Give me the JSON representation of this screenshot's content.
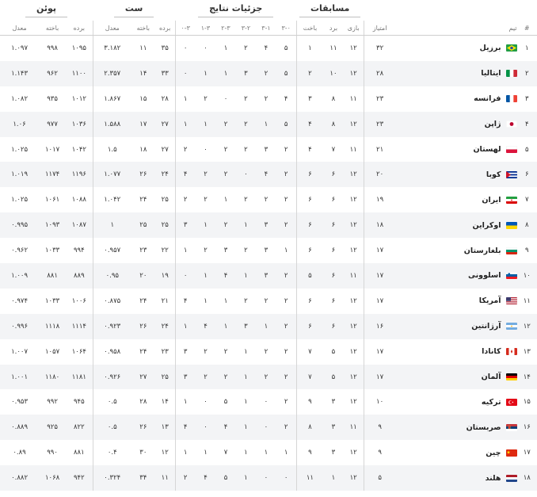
{
  "headers": {
    "groups": {
      "matches": "مسابقات",
      "details": "جزئیات نتایج",
      "sets": "ست",
      "points": "پوئن"
    },
    "columns": {
      "num": "#",
      "team": "تیم",
      "score": "امتیاز",
      "played": "بازی",
      "won": "برد",
      "lost": "باخت",
      "r30": "۳-۰",
      "r31": "۳-۱",
      "r32": "۳-۲",
      "r23": "۲-۳",
      "r13": "۱-۳",
      "r03": "۰-۳",
      "sets_won": "برده",
      "sets_lost": "باخته",
      "sets_ratio": "معدل",
      "pts_won": "برده",
      "pts_lost": "باخته",
      "pts_ratio": "معدل"
    }
  },
  "rows": [
    {
      "rank": "۱",
      "team": "برزیل",
      "flag": "brazil",
      "score": "۳۲",
      "played": "۱۲",
      "won": "۱۱",
      "lost": "۱",
      "r30": "۵",
      "r31": "۴",
      "r32": "۲",
      "r23": "۱",
      "r13": "۰",
      "r03": "۰",
      "sets_won": "۳۵",
      "sets_lost": "۱۱",
      "sets_ratio": "۳.۱۸۲",
      "pts_won": "۱۰۹۵",
      "pts_lost": "۹۹۸",
      "pts_ratio": "۱.۰۹۷"
    },
    {
      "rank": "۲",
      "team": "ایتالیا",
      "flag": "italy",
      "score": "۲۸",
      "played": "۱۲",
      "won": "۱۰",
      "lost": "۲",
      "r30": "۵",
      "r31": "۲",
      "r32": "۳",
      "r23": "۱",
      "r13": "۱",
      "r03": "۰",
      "sets_won": "۳۳",
      "sets_lost": "۱۴",
      "sets_ratio": "۲.۳۵۷",
      "pts_won": "۱۱۰۰",
      "pts_lost": "۹۶۲",
      "pts_ratio": "۱.۱۴۳"
    },
    {
      "rank": "۳",
      "team": "فرانسه",
      "flag": "france",
      "score": "۲۳",
      "played": "۱۱",
      "won": "۸",
      "lost": "۳",
      "r30": "۴",
      "r31": "۲",
      "r32": "۲",
      "r23": "۰",
      "r13": "۲",
      "r03": "۱",
      "sets_won": "۲۸",
      "sets_lost": "۱۵",
      "sets_ratio": "۱.۸۶۷",
      "pts_won": "۱۰۱۲",
      "pts_lost": "۹۳۵",
      "pts_ratio": "۱.۰۸۲"
    },
    {
      "rank": "۴",
      "team": "ژاپن",
      "flag": "japan",
      "score": "۲۳",
      "played": "۱۲",
      "won": "۸",
      "lost": "۴",
      "r30": "۵",
      "r31": "۱",
      "r32": "۲",
      "r23": "۲",
      "r13": "۱",
      "r03": "۱",
      "sets_won": "۲۷",
      "sets_lost": "۱۷",
      "sets_ratio": "۱.۵۸۸",
      "pts_won": "۱۰۳۶",
      "pts_lost": "۹۷۷",
      "pts_ratio": "۱.۰۶"
    },
    {
      "rank": "۵",
      "team": "لهستان",
      "flag": "poland",
      "score": "۲۱",
      "played": "۱۱",
      "won": "۷",
      "lost": "۴",
      "r30": "۲",
      "r31": "۳",
      "r32": "۲",
      "r23": "۲",
      "r13": "۰",
      "r03": "۲",
      "sets_won": "۲۷",
      "sets_lost": "۱۸",
      "sets_ratio": "۱.۵",
      "pts_won": "۱۰۴۲",
      "pts_lost": "۱۰۱۷",
      "pts_ratio": "۱.۰۲۵"
    },
    {
      "rank": "۶",
      "team": "کوبا",
      "flag": "cuba",
      "score": "۲۰",
      "played": "۱۲",
      "won": "۶",
      "lost": "۶",
      "r30": "۲",
      "r31": "۴",
      "r32": "۰",
      "r23": "۲",
      "r13": "۲",
      "r03": "۴",
      "sets_won": "۲۴",
      "sets_lost": "۲۶",
      "sets_ratio": "۱.۰۷۷",
      "pts_won": "۱۱۹۶",
      "pts_lost": "۱۱۷۴",
      "pts_ratio": "۱.۰۱۹"
    },
    {
      "rank": "۷",
      "team": "ایران",
      "flag": "iran",
      "score": "۱۹",
      "played": "۱۲",
      "won": "۶",
      "lost": "۶",
      "r30": "۲",
      "r31": "۲",
      "r32": "۲",
      "r23": "۱",
      "r13": "۲",
      "r03": "۲",
      "sets_won": "۲۵",
      "sets_lost": "۲۴",
      "sets_ratio": "۱.۰۴۲",
      "pts_won": "۱۰۸۸",
      "pts_lost": "۱۰۶۱",
      "pts_ratio": "۱.۰۲۵"
    },
    {
      "rank": "۸",
      "team": "اوکراین",
      "flag": "ukraine",
      "score": "۱۸",
      "played": "۱۲",
      "won": "۶",
      "lost": "۶",
      "r30": "۲",
      "r31": "۳",
      "r32": "۱",
      "r23": "۲",
      "r13": "۱",
      "r03": "۳",
      "sets_won": "۲۵",
      "sets_lost": "۲۵",
      "sets_ratio": "۱",
      "pts_won": "۱۰۸۷",
      "pts_lost": "۱۰۹۳",
      "pts_ratio": "۰.۹۹۵"
    },
    {
      "rank": "۹",
      "team": "بلغارستان",
      "flag": "bulgaria",
      "score": "۱۷",
      "played": "۱۲",
      "won": "۶",
      "lost": "۶",
      "r30": "۱",
      "r31": "۳",
      "r32": "۲",
      "r23": "۳",
      "r13": "۲",
      "r03": "۱",
      "sets_won": "۲۲",
      "sets_lost": "۲۳",
      "sets_ratio": "۰.۹۵۷",
      "pts_won": "۹۹۴",
      "pts_lost": "۱۰۳۳",
      "pts_ratio": "۰.۹۶۲"
    },
    {
      "rank": "۱۰",
      "team": "اسلوونی",
      "flag": "slovenia",
      "score": "۱۷",
      "played": "۱۱",
      "won": "۶",
      "lost": "۵",
      "r30": "۲",
      "r31": "۳",
      "r32": "۱",
      "r23": "۴",
      "r13": "۱",
      "r03": "۰",
      "sets_won": "۱۹",
      "sets_lost": "۲۰",
      "sets_ratio": "۰.۹۵",
      "pts_won": "۸۸۹",
      "pts_lost": "۸۸۱",
      "pts_ratio": "۱.۰۰۹"
    },
    {
      "rank": "۱۱",
      "team": "آمریکا",
      "flag": "usa",
      "score": "۱۷",
      "played": "۱۲",
      "won": "۶",
      "lost": "۶",
      "r30": "۲",
      "r31": "۲",
      "r32": "۲",
      "r23": "۱",
      "r13": "۱",
      "r03": "۴",
      "sets_won": "۲۱",
      "sets_lost": "۲۴",
      "sets_ratio": "۰.۸۷۵",
      "pts_won": "۱۰۰۶",
      "pts_lost": "۱۰۳۳",
      "pts_ratio": "۰.۹۷۴"
    },
    {
      "rank": "۱۲",
      "team": "آرژانتین",
      "flag": "argentina",
      "score": "۱۶",
      "played": "۱۲",
      "won": "۶",
      "lost": "۶",
      "r30": "۲",
      "r31": "۱",
      "r32": "۳",
      "r23": "۱",
      "r13": "۴",
      "r03": "۱",
      "sets_won": "۲۴",
      "sets_lost": "۲۶",
      "sets_ratio": "۰.۹۲۳",
      "pts_won": "۱۱۱۴",
      "pts_lost": "۱۱۱۸",
      "pts_ratio": "۰.۹۹۶"
    },
    {
      "rank": "۱۳",
      "team": "کانادا",
      "flag": "canada",
      "score": "۱۷",
      "played": "۱۲",
      "won": "۵",
      "lost": "۷",
      "r30": "۲",
      "r31": "۲",
      "r32": "۱",
      "r23": "۲",
      "r13": "۲",
      "r03": "۳",
      "sets_won": "۲۳",
      "sets_lost": "۲۴",
      "sets_ratio": "۰.۹۵۸",
      "pts_won": "۱۰۶۴",
      "pts_lost": "۱۰۵۷",
      "pts_ratio": "۱.۰۰۷"
    },
    {
      "rank": "۱۴",
      "team": "آلمان",
      "flag": "germany",
      "score": "۱۷",
      "played": "۱۲",
      "won": "۵",
      "lost": "۷",
      "r30": "۲",
      "r31": "۲",
      "r32": "۱",
      "r23": "۲",
      "r13": "۲",
      "r03": "۳",
      "sets_won": "۲۵",
      "sets_lost": "۲۷",
      "sets_ratio": "۰.۹۲۶",
      "pts_won": "۱۱۸۱",
      "pts_lost": "۱۱۸۰",
      "pts_ratio": "۱.۰۰۱"
    },
    {
      "rank": "۱۵",
      "team": "ترکیه",
      "flag": "turkey",
      "score": "۱۰",
      "played": "۱۲",
      "won": "۳",
      "lost": "۹",
      "r30": "۲",
      "r31": "۰",
      "r32": "۱",
      "r23": "۵",
      "r13": "۰",
      "r03": "۱",
      "sets_won": "۱۴",
      "sets_lost": "۲۸",
      "sets_ratio": "۰.۵",
      "pts_won": "۹۴۵",
      "pts_lost": "۹۹۲",
      "pts_ratio": "۰.۹۵۳"
    },
    {
      "rank": "۱۶",
      "team": "صربستان",
      "flag": "serbia",
      "score": "۹",
      "played": "۱۱",
      "won": "۳",
      "lost": "۸",
      "r30": "۲",
      "r31": "۰",
      "r32": "۱",
      "r23": "۴",
      "r13": "۰",
      "r03": "۴",
      "sets_won": "۱۳",
      "sets_lost": "۲۶",
      "sets_ratio": "۰.۵",
      "pts_won": "۸۲۲",
      "pts_lost": "۹۲۵",
      "pts_ratio": "۰.۸۸۹"
    },
    {
      "rank": "۱۷",
      "team": "چین",
      "flag": "china",
      "score": "۹",
      "played": "۱۲",
      "won": "۳",
      "lost": "۹",
      "r30": "۱",
      "r31": "۱",
      "r32": "۱",
      "r23": "۷",
      "r13": "۱",
      "r03": "۱",
      "sets_won": "۱۲",
      "sets_lost": "۳۰",
      "sets_ratio": "۰.۴",
      "pts_won": "۸۸۱",
      "pts_lost": "۹۹۰",
      "pts_ratio": "۰.۸۹"
    },
    {
      "rank": "۱۸",
      "team": "هلند",
      "flag": "netherlands",
      "score": "۵",
      "played": "۱۲",
      "won": "۱",
      "lost": "۱۱",
      "r30": "۰",
      "r31": "۰",
      "r32": "۱",
      "r23": "۵",
      "r13": "۴",
      "r03": "۲",
      "sets_won": "۱۱",
      "sets_lost": "۳۴",
      "sets_ratio": "۰.۳۲۴",
      "pts_won": "۹۴۲",
      "pts_lost": "۱۰۶۸",
      "pts_ratio": "۰.۸۸۲"
    }
  ]
}
